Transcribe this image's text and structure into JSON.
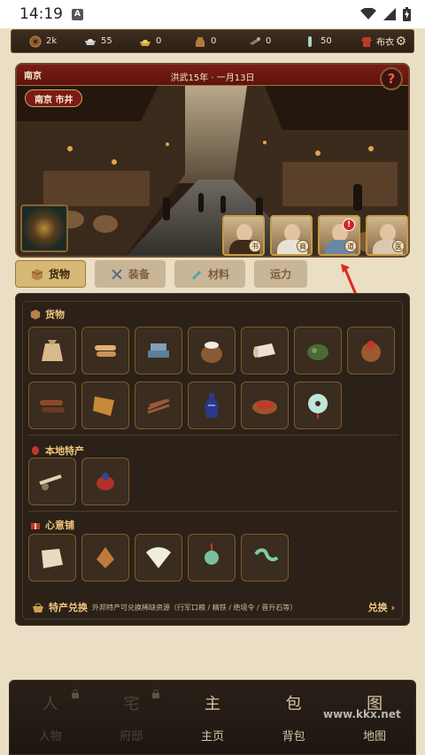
{
  "status_bar": {
    "time": "14:19",
    "badge": "A"
  },
  "resources": [
    {
      "icon": "coin-icon",
      "value": "2k"
    },
    {
      "icon": "silver-ingot-icon",
      "value": "55"
    },
    {
      "icon": "gold-ingot-icon",
      "value": "0"
    },
    {
      "icon": "grain-jar-icon",
      "value": "0"
    },
    {
      "icon": "tool-icon",
      "value": "0"
    },
    {
      "icon": "jade-icon",
      "value": "50"
    }
  ],
  "cloth": {
    "label": "布衣"
  },
  "scene": {
    "city": "南京",
    "date": "洪武15年 · 一月13日",
    "location": "南京 市井",
    "help": "?",
    "npcs": [
      {
        "tag": "书",
        "alert": false
      },
      {
        "tag": "商",
        "alert": false
      },
      {
        "tag": "道",
        "alert": true,
        "alert_text": "!"
      },
      {
        "tag": "医",
        "alert": false
      }
    ]
  },
  "tabs": [
    {
      "label": "货物",
      "icon": "box-icon",
      "active": true
    },
    {
      "label": "装备",
      "icon": "swords-icon",
      "active": false
    },
    {
      "label": "材料",
      "icon": "brush-icon",
      "active": false
    },
    {
      "label": "运力",
      "icon": "",
      "active": false
    }
  ],
  "inventory": {
    "sections": [
      {
        "title": "货物",
        "icon": "box-icon",
        "items": [
          "grain-sack-icon",
          "scroll-bundle-icon",
          "ingot-stack-icon",
          "salt-jar-icon",
          "cloth-roll-icon",
          "tea-icon",
          "fruit-icon",
          "logs-icon",
          "paper-icon",
          "herbs-icon",
          "vase-icon",
          "dish-icon",
          "jade-disc-icon"
        ]
      },
      {
        "title": "本地特产",
        "icon": "lantern-icon",
        "items": [
          "cart-icon",
          "pouch-icon"
        ]
      },
      {
        "title": "心意铺",
        "icon": "gift-icon",
        "items": [
          "letter-icon",
          "sachet-icon",
          "fan-icon",
          "pendant-icon",
          "jade-hook-icon"
        ]
      }
    ],
    "exchange": {
      "title": "特产兑换",
      "desc": "外邦特产可兑换稀缺资源（行军口粮 / 精铁 / 绝境令 / 晋升石等）",
      "button": "兑换 ›"
    }
  },
  "nav": [
    {
      "icon": "人",
      "label": "人物",
      "locked": true
    },
    {
      "icon": "宅",
      "label": "府邸",
      "locked": true
    },
    {
      "icon": "主",
      "label": "主页",
      "locked": false
    },
    {
      "icon": "包",
      "label": "背包",
      "locked": false
    },
    {
      "icon": "图",
      "label": "地图",
      "locked": false
    }
  ],
  "watermark": "www.kkx.net"
}
